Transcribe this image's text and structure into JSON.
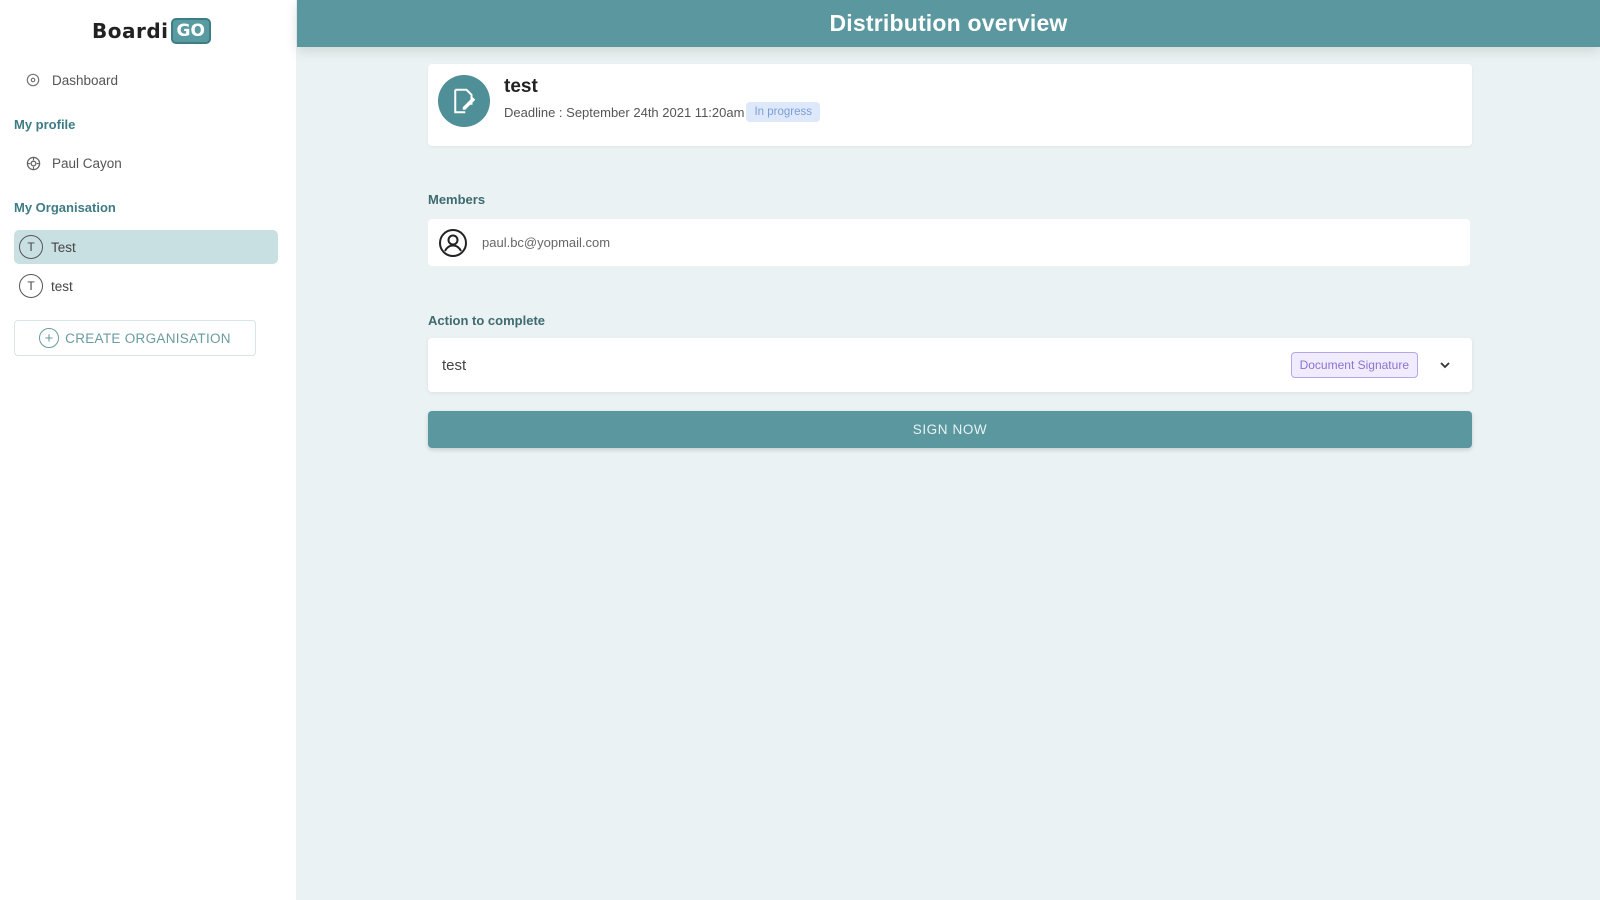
{
  "app": {
    "logo_text": "Boardi",
    "logo_badge": "GO"
  },
  "sidebar": {
    "dashboard_label": "Dashboard",
    "profile_section": "My profile",
    "profile_name": "Paul Cayon",
    "org_section": "My Organisation",
    "organisations": [
      {
        "initial": "T",
        "label": "Test",
        "active": true
      },
      {
        "initial": "T",
        "label": "test",
        "active": false
      }
    ],
    "create_org_label": "CREATE ORGANISATION"
  },
  "header": {
    "title": "Distribution overview"
  },
  "distribution": {
    "title": "test",
    "deadline": "Deadline : September 24th 2021 11:20am",
    "status": "In progress"
  },
  "members": {
    "label": "Members",
    "items": [
      {
        "email": "paul.bc@yopmail.com"
      }
    ]
  },
  "action": {
    "label": "Action to complete",
    "name": "test",
    "type_badge": "Document Signature"
  },
  "sign_button_label": "SIGN NOW",
  "colors": {
    "primary": "#5a979e",
    "sidebar_active": "#c9e0e2",
    "background": "#eaf2f3",
    "status_badge": "#dde9fb",
    "doc_badge": "#f1ecfd"
  }
}
